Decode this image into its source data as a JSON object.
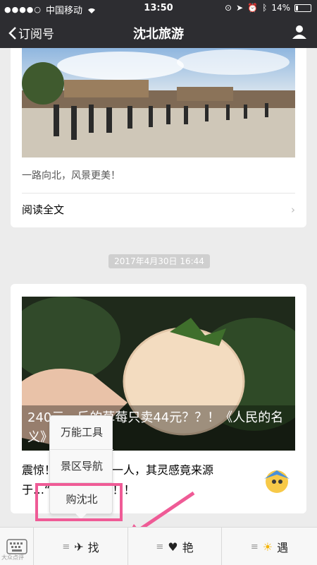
{
  "status_bar": {
    "carrier": "中国移动",
    "time": "13:50",
    "battery": "14%"
  },
  "nav": {
    "back_label": "订阅号",
    "title": "沈北旅游"
  },
  "article1": {
    "caption": "一路向北，风景更美！",
    "read_full": "阅读全文"
  },
  "timestamp": "2017年4月30日 16:44",
  "article2": {
    "headline": "240元一斤的草莓只卖44元？？！《人民的名义》即将上映！",
    "body": "震惊！沈北旅游第一人，其灵感竟来源于…“购沈北”事件！！"
  },
  "popup_menu": {
    "items": [
      "万能工具",
      "景区导航",
      "购沈北"
    ]
  },
  "bottom_bar": {
    "tabs": [
      {
        "label": "找",
        "icon": "plane-icon"
      },
      {
        "label": "艳",
        "icon": "heart-icon"
      },
      {
        "label": "遇",
        "icon": "sun-icon"
      }
    ]
  },
  "watermark": "大众点评"
}
